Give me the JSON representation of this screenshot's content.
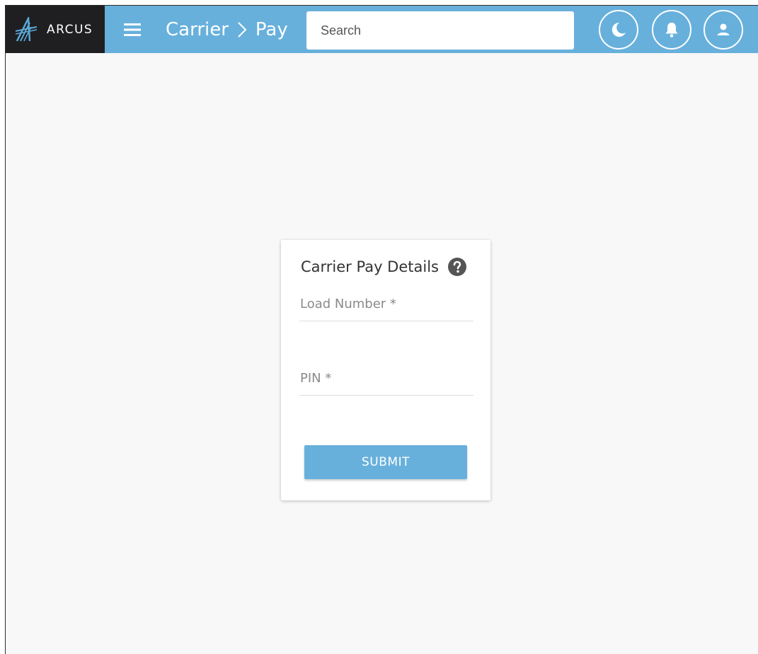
{
  "brand": {
    "name": "ARCUS",
    "logo_icon": "arcus-logo-icon"
  },
  "header": {
    "menu_icon": "hamburger-menu-icon",
    "breadcrumb": [
      "Carrier",
      "Pay"
    ],
    "breadcrumb_separator_icon": "chevron-right-icon",
    "search_placeholder": "Search",
    "search_value": "",
    "actions": [
      {
        "name": "theme-toggle-button",
        "icon": "moon-icon"
      },
      {
        "name": "notifications-button",
        "icon": "bell-icon"
      },
      {
        "name": "profile-button",
        "icon": "user-icon"
      }
    ]
  },
  "form": {
    "title": "Carrier Pay Details",
    "help_icon": "help-icon",
    "load_number_label": "Load Number *",
    "load_number_value": "",
    "pin_label": "PIN *",
    "pin_value": "",
    "submit_label": "SUBMIT"
  },
  "colors": {
    "header_bg": "#67b0dc",
    "brand_bg": "#1f1f22",
    "page_bg": "#f8f8f8",
    "button_bg": "#67b0dc",
    "help_icon": "#555555"
  }
}
